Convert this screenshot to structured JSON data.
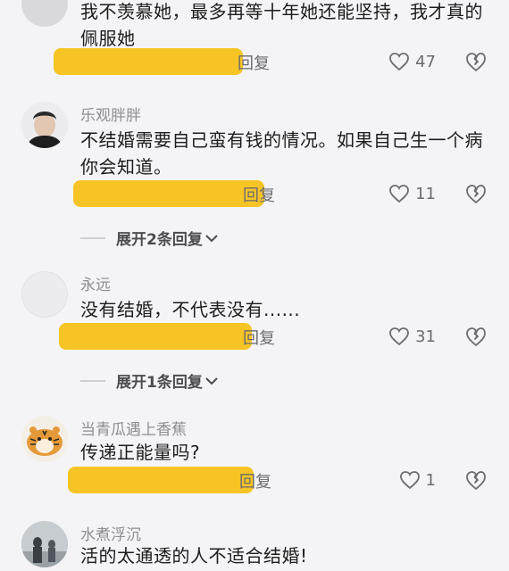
{
  "comments": [
    {
      "username": "",
      "text": "我不羡慕她，最多再等十年她还能坚持，我才真的佩服她",
      "reply_label": "回复",
      "likes": "47"
    },
    {
      "username": "乐观胖胖",
      "text": "不结婚需要自己蛮有钱的情况。如果自己生一个病你会知道。",
      "reply_label": "回复",
      "likes": "11",
      "expand_label": "展开2条回复"
    },
    {
      "username": "永远",
      "text": "没有结婚，不代表没有......",
      "reply_label": "回复",
      "likes": "31",
      "expand_label": "展开1条回复"
    },
    {
      "username": "当青瓜遇上香蕉",
      "text": "传递正能量吗?",
      "reply_label": "回复",
      "likes": "1"
    },
    {
      "username": "水煮浮沉",
      "text": "活的太通透的人不适合结婚!"
    }
  ],
  "icons": {
    "like": "heart-icon",
    "dislike": "broken-heart-icon",
    "chevron": "chevron-down-icon"
  },
  "colors": {
    "highlight": "#f5c119",
    "meta_text": "#6b6b70",
    "username_text": "#8d8d92"
  }
}
